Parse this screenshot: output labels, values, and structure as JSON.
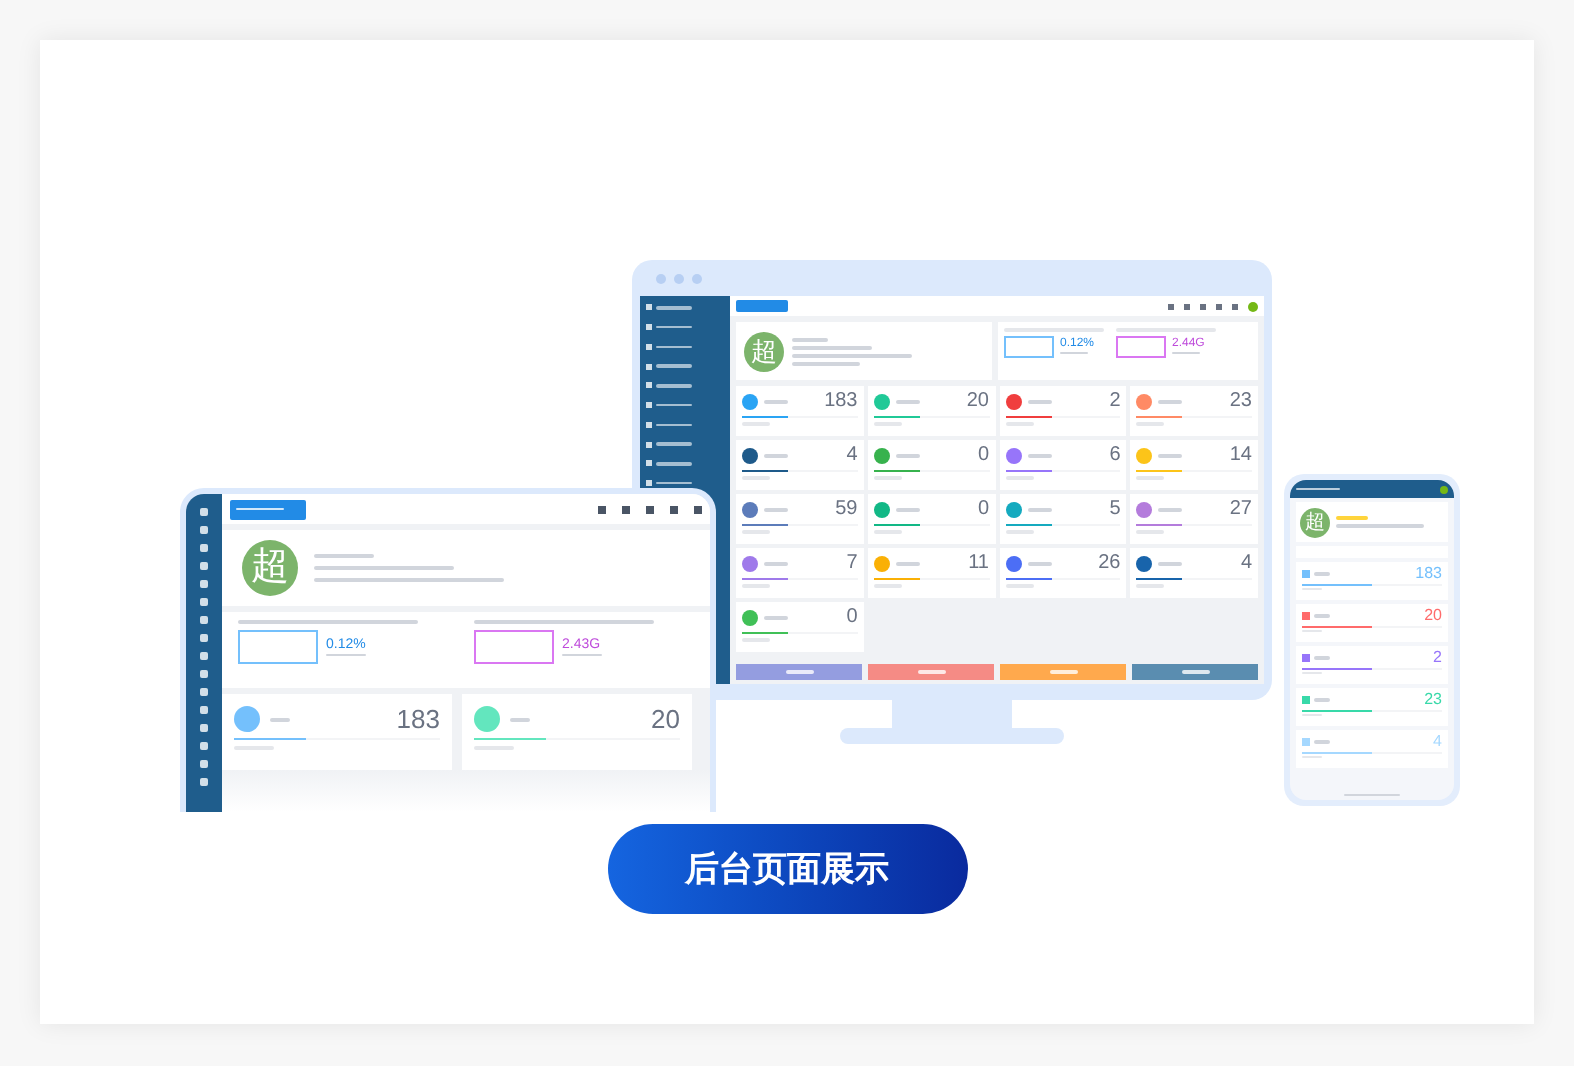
{
  "monitor": {
    "avatar": "超",
    "cpu": "0.12%",
    "memory": "2.44G",
    "tiles": [
      {
        "value": "183",
        "color": "#2aa4f4",
        "level": 0.4
      },
      {
        "value": "20",
        "color": "#20c997",
        "level": 0.4
      },
      {
        "value": "2",
        "color": "#f03e3e",
        "level": 0.4
      },
      {
        "value": "23",
        "color": "#ff8a65",
        "level": 0.4
      },
      {
        "value": "4",
        "color": "#1e5a8a",
        "level": 0.4
      },
      {
        "value": "0",
        "color": "#37b24d",
        "level": 0.4
      },
      {
        "value": "6",
        "color": "#9775fa",
        "level": 0.4
      },
      {
        "value": "14",
        "color": "#fcc419",
        "level": 0.4
      },
      {
        "value": "59",
        "color": "#5c7cba",
        "level": 0.4
      },
      {
        "value": "0",
        "color": "#12b886",
        "level": 0.4
      },
      {
        "value": "5",
        "color": "#15aabf",
        "level": 0.4
      },
      {
        "value": "27",
        "color": "#b47cdc",
        "level": 0.4
      },
      {
        "value": "7",
        "color": "#9f7aea",
        "level": 0.4
      },
      {
        "value": "11",
        "color": "#fab005",
        "level": 0.4
      },
      {
        "value": "26",
        "color": "#4c6ef5",
        "level": 0.4
      },
      {
        "value": "4",
        "color": "#1864ab",
        "level": 0.4
      },
      {
        "value": "0",
        "color": "#40c057",
        "level": 0.4
      }
    ],
    "actions": [
      {
        "color": "#949de0"
      },
      {
        "color": "#f58b85"
      },
      {
        "color": "#ffa94d"
      },
      {
        "color": "#5a8db0"
      }
    ]
  },
  "tablet": {
    "avatar": "超",
    "cpu": "0.12%",
    "memory": "2.43G",
    "tiles": [
      {
        "value": "183",
        "color": "#74c0fc",
        "level": 0.35
      },
      {
        "value": "20",
        "color": "#63e6be",
        "level": 0.35
      }
    ]
  },
  "phone": {
    "avatar": "超",
    "tiles": [
      {
        "value": "183",
        "color": "#74c0fc",
        "level": 0.5
      },
      {
        "value": "20",
        "color": "#ff6b6b",
        "level": 0.5
      },
      {
        "value": "2",
        "color": "#9775fa",
        "level": 0.5
      },
      {
        "value": "23",
        "color": "#38d9a9",
        "level": 0.5
      },
      {
        "value": "4",
        "color": "#a5d8ff",
        "level": 0.5
      }
    ]
  },
  "cta": "后台页面展示"
}
